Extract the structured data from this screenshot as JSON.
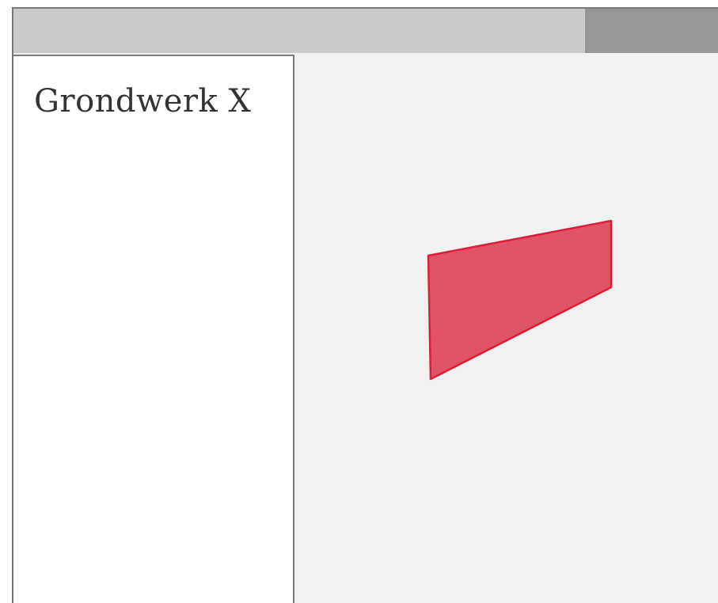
{
  "app": {
    "title": "Grondwerk X"
  },
  "colors": {
    "titlebar": "#cacaca",
    "titlebar_handle": "#979797",
    "canvas_background": "#f1f1f1",
    "sidebar_background": "#ffffff",
    "border": "#7a7a7a",
    "shape_fill": "#e05465",
    "shape_stroke": "#dd1c38"
  },
  "canvas": {
    "shape": {
      "type": "quadrilateral"
    }
  }
}
